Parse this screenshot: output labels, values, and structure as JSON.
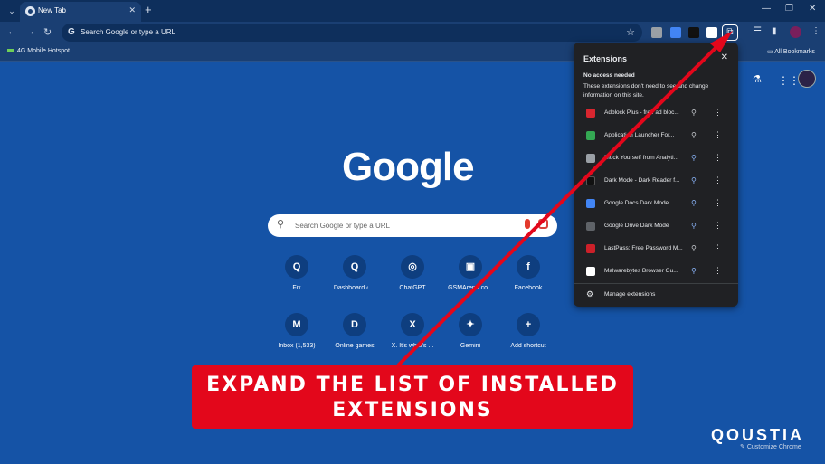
{
  "tabstrip": {
    "tab_title": "New Tab",
    "tab_close": "✕",
    "new_tab": "+",
    "minimize": "—",
    "maximize": "❐",
    "close": "✕",
    "tab_search": "⌄"
  },
  "toolbar": {
    "back": "←",
    "forward": "→",
    "reload": "↻",
    "omnibox_text": "Search Google or type a URL",
    "star": "☆",
    "puzzle": "⧉"
  },
  "bookmarks": {
    "item": "4G Mobile Hotspot",
    "all": "All Bookmarks"
  },
  "ntp": {
    "logo": "Google",
    "search_placeholder": "Search Google or type a URL",
    "shortcuts_row1": [
      {
        "label": "Fix",
        "glyph": "Q"
      },
      {
        "label": "Dashboard ‹ ...",
        "glyph": "Q"
      },
      {
        "label": "ChatGPT",
        "glyph": "◎"
      },
      {
        "label": "GSMArena.co...",
        "glyph": "▣"
      },
      {
        "label": "Facebook",
        "glyph": "f"
      }
    ],
    "shortcuts_row2": [
      {
        "label": "Inbox (1,533)",
        "glyph": "M"
      },
      {
        "label": "Online games",
        "glyph": "D"
      },
      {
        "label": "X. It's what's ...",
        "glyph": "X"
      },
      {
        "label": "Gemini",
        "glyph": "✦"
      },
      {
        "label": "Add shortcut",
        "glyph": "+"
      }
    ]
  },
  "extensions_panel": {
    "title": "Extensions",
    "close": "✕",
    "section_title": "No access needed",
    "section_desc": "These extensions don't need to see and change information on this site.",
    "items": [
      {
        "name": "Adblock Plus - free ad bloc...",
        "icon_color": "#d8262f",
        "pinned": false
      },
      {
        "name": "Application Launcher For...",
        "icon_color": "#34a853",
        "pinned": false
      },
      {
        "name": "Block Yourself from Analyti...",
        "icon_color": "#9aa0a6",
        "pinned": true
      },
      {
        "name": "Dark Mode - Dark Reader f...",
        "icon_color": "#111111",
        "pinned": true
      },
      {
        "name": "Google Docs Dark Mode",
        "icon_color": "#4285f4",
        "pinned": true
      },
      {
        "name": "Google Drive Dark Mode",
        "icon_color": "#5f6368",
        "pinned": true
      },
      {
        "name": "LastPass: Free Password M...",
        "icon_color": "#cc2029",
        "pinned": false
      },
      {
        "name": "Malwarebytes Browser Gu...",
        "icon_color": "#ffffff",
        "pinned": true
      }
    ],
    "pin_glyph": "⚲",
    "more_glyph": "⋮",
    "manage_label": "Manage extensions",
    "manage_icon": "⚙"
  },
  "callout": {
    "line1": "EXPAND THE LIST OF INSTALLED",
    "line2": "EXTENSIONS"
  },
  "watermark": "QOUSTIA",
  "customize": "Customize Chrome",
  "colors": {
    "background": "#1553a6",
    "panel": "#202124",
    "callout": "#e3071b",
    "arrow": "#e3071b"
  }
}
